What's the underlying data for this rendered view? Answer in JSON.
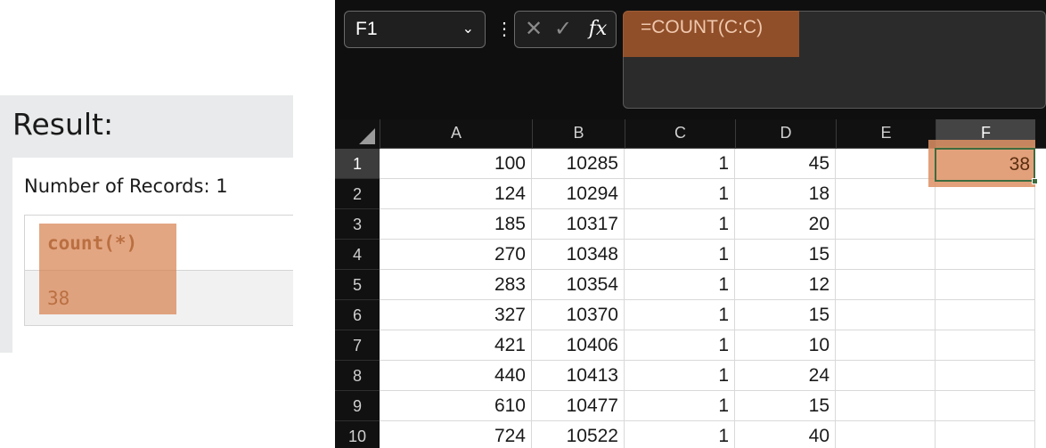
{
  "sql_result": {
    "title": "Result:",
    "record_count_text": "Number of Records: 1",
    "column_header": "count(*)",
    "value": "38",
    "highlight_color": "#d88352"
  },
  "excel": {
    "name_box": "F1",
    "formula": "=COUNT(C:C)",
    "formula_highlight_color": "#b75d28",
    "fx_label": "fx",
    "columns": [
      "A",
      "B",
      "C",
      "D",
      "E",
      "F"
    ],
    "active_column": "F",
    "active_row": "1",
    "rows": [
      {
        "row": "1",
        "a": "100",
        "b": "10285",
        "c": "1",
        "d": "45",
        "e": "",
        "f": "38"
      },
      {
        "row": "2",
        "a": "124",
        "b": "10294",
        "c": "1",
        "d": "18",
        "e": "",
        "f": ""
      },
      {
        "row": "3",
        "a": "185",
        "b": "10317",
        "c": "1",
        "d": "20",
        "e": "",
        "f": ""
      },
      {
        "row": "4",
        "a": "270",
        "b": "10348",
        "c": "1",
        "d": "15",
        "e": "",
        "f": ""
      },
      {
        "row": "5",
        "a": "283",
        "b": "10354",
        "c": "1",
        "d": "12",
        "e": "",
        "f": ""
      },
      {
        "row": "6",
        "a": "327",
        "b": "10370",
        "c": "1",
        "d": "15",
        "e": "",
        "f": ""
      },
      {
        "row": "7",
        "a": "421",
        "b": "10406",
        "c": "1",
        "d": "10",
        "e": "",
        "f": ""
      },
      {
        "row": "8",
        "a": "440",
        "b": "10413",
        "c": "1",
        "d": "24",
        "e": "",
        "f": ""
      },
      {
        "row": "9",
        "a": "610",
        "b": "10477",
        "c": "1",
        "d": "15",
        "e": "",
        "f": ""
      },
      {
        "row": "10",
        "a": "724",
        "b": "10522",
        "c": "1",
        "d": "40",
        "e": "",
        "f": ""
      }
    ],
    "selected_cell_value": "38"
  }
}
